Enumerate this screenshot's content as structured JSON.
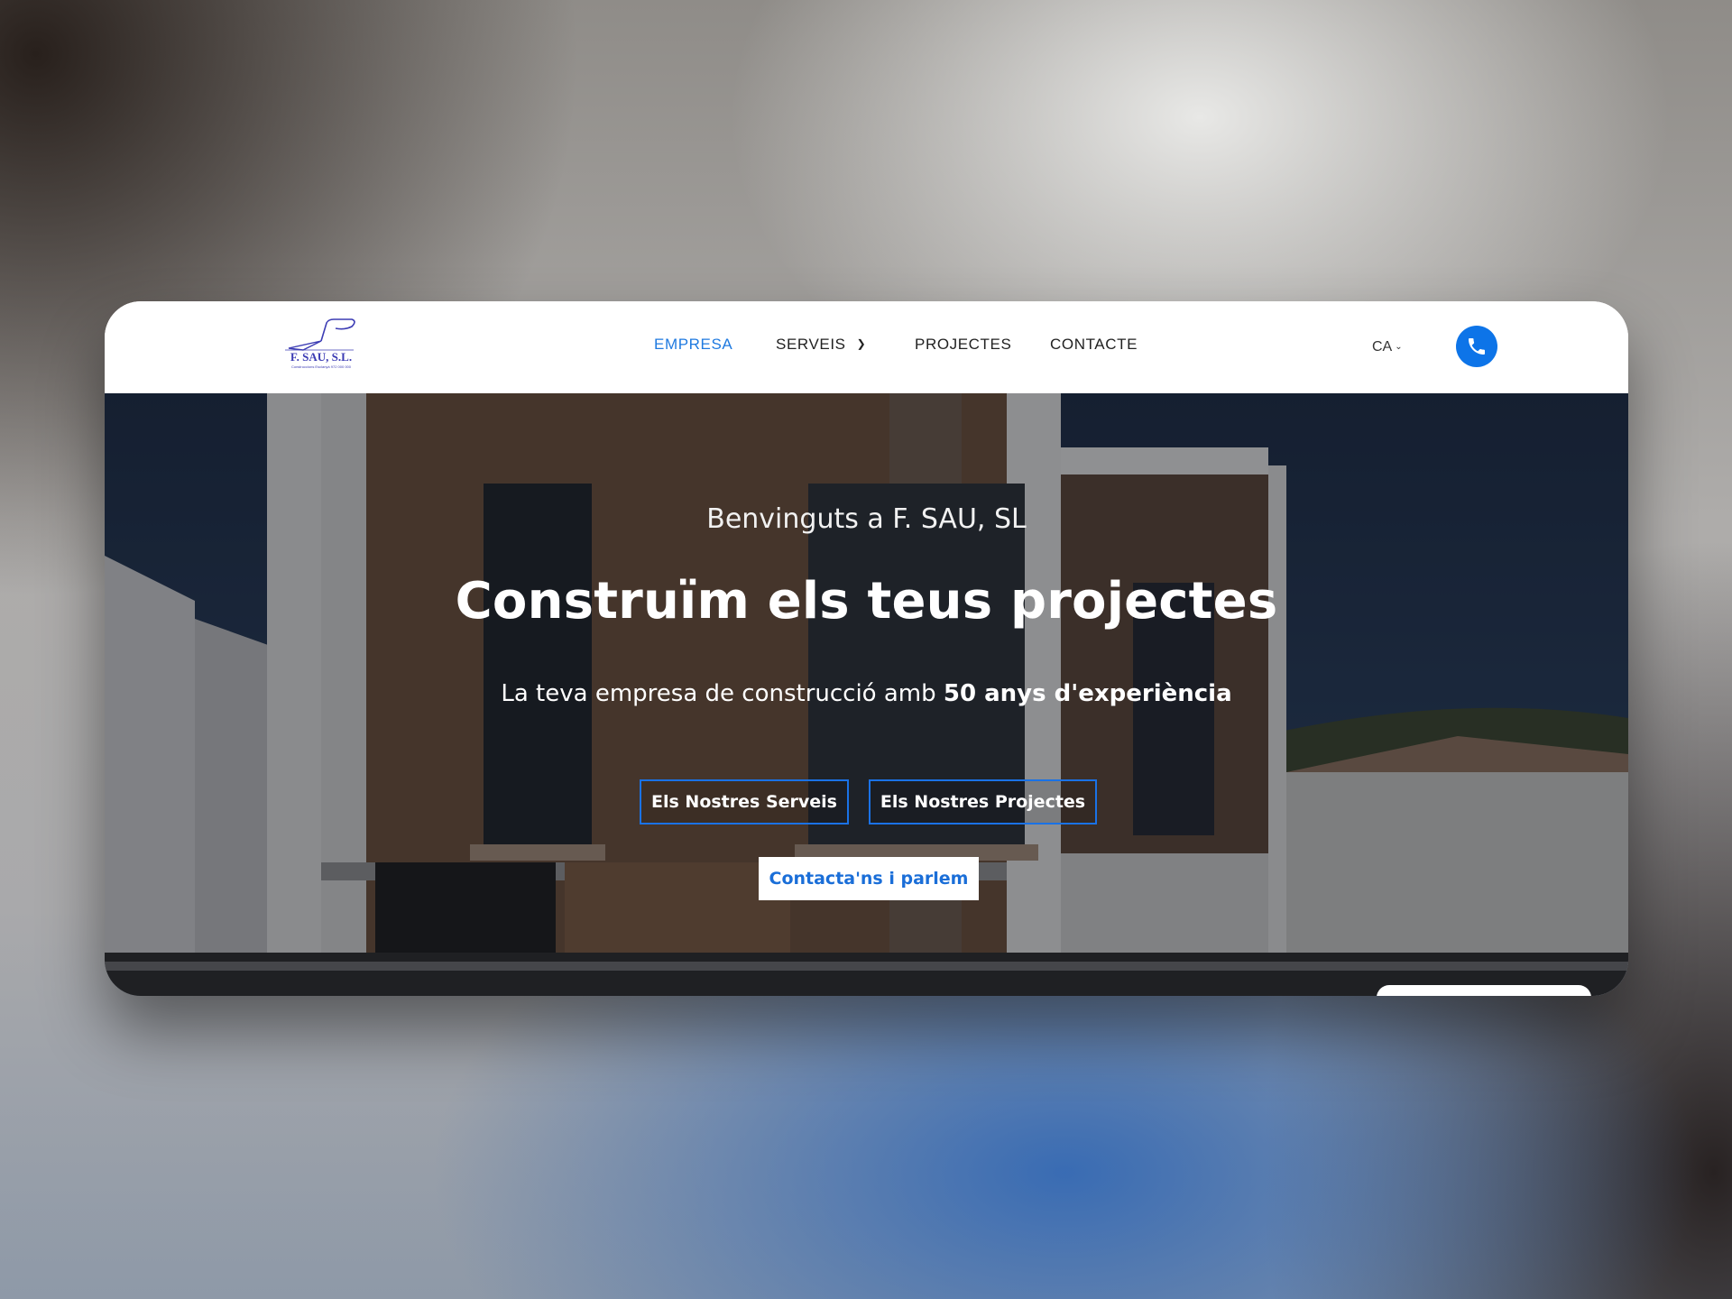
{
  "brand": {
    "logo_text": "F. SAU, S.L.",
    "logo_subtext": "Construccions Esclanyà 972 000 000"
  },
  "nav": {
    "items": [
      {
        "label": "EMPRESA",
        "active": true
      },
      {
        "label": "SERVEIS",
        "has_dropdown": true
      },
      {
        "label": "PROJECTES"
      },
      {
        "label": "CONTACTE"
      }
    ]
  },
  "language": {
    "selected": "CA"
  },
  "phone": {
    "icon": "phone-icon"
  },
  "hero": {
    "welcome": "Benvinguts a F. SAU, SL",
    "headline": "Construïm els teus projectes",
    "tagline_prefix": "La teva empresa de construcció amb ",
    "tagline_bold": "50 anys d'experiència",
    "buttons": {
      "services": "Els Nostres Serveis",
      "projects": "Els Nostres Projectes",
      "contact": "Contacta'ns i parlem"
    }
  },
  "colors": {
    "accent": "#1f7ae0",
    "phone_button": "#0d74e8",
    "logo_blue": "#3c3cb4"
  }
}
